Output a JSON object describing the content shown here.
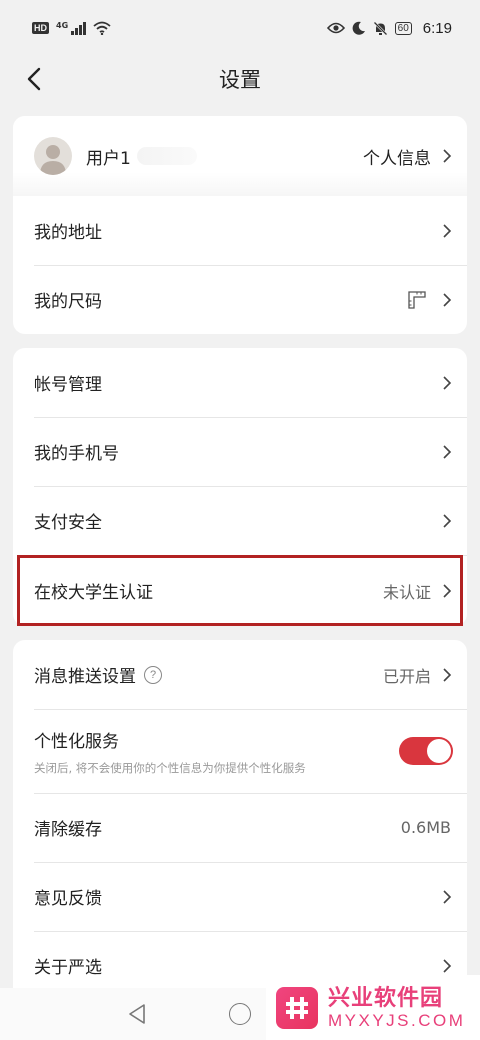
{
  "status_bar": {
    "hd": "HD",
    "network": "4G",
    "battery": "60",
    "time": "6:19"
  },
  "header": {
    "title": "设置"
  },
  "profile": {
    "username": "用户1",
    "link_label": "个人信息"
  },
  "group1": {
    "address": "我的地址",
    "size": "我的尺码"
  },
  "group2": {
    "account": "帐号管理",
    "phone": "我的手机号",
    "payment": "支付安全",
    "student_label": "在校大学生认证",
    "student_status": "未认证"
  },
  "group3": {
    "push_label": "消息推送设置",
    "push_help": "?",
    "push_status": "已开启",
    "personal_label": "个性化服务",
    "personal_desc": "关闭后, 将不会使用你的个性信息为你提供个性化服务",
    "personal_enabled": true,
    "cache_label": "清除缓存",
    "cache_size": "0.6MB",
    "feedback": "意见反馈",
    "about": "关于严选"
  },
  "watermark": {
    "cn": "兴业软件园",
    "en": "MYXYJS.COM"
  },
  "colors": {
    "accent": "#d9363e",
    "highlight_border": "#b22222",
    "watermark": "#e8407a"
  }
}
